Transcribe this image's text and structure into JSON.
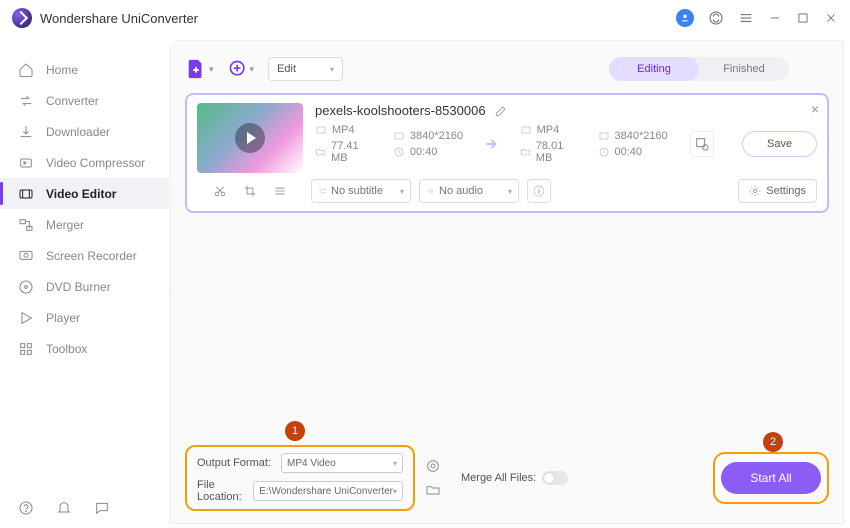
{
  "app": {
    "title": "Wondershare UniConverter"
  },
  "sidebar": {
    "items": [
      {
        "label": "Home"
      },
      {
        "label": "Converter"
      },
      {
        "label": "Downloader"
      },
      {
        "label": "Video Compressor"
      },
      {
        "label": "Video Editor"
      },
      {
        "label": "Merger"
      },
      {
        "label": "Screen Recorder"
      },
      {
        "label": "DVD Burner"
      },
      {
        "label": "Player"
      },
      {
        "label": "Toolbox"
      }
    ]
  },
  "toolbar": {
    "edit_dd": "Edit",
    "tabs": {
      "editing": "Editing",
      "finished": "Finished"
    }
  },
  "card": {
    "filename": "pexels-koolshooters-8530006",
    "src": {
      "format": "MP4",
      "resolution": "3840*2160",
      "size": "77.41 MB",
      "duration": "00:40"
    },
    "dst": {
      "format": "MP4",
      "resolution": "3840*2160",
      "size": "78.01 MB",
      "duration": "00:40"
    },
    "subtitle_dd": "No subtitle",
    "audio_dd": "No audio",
    "settings_label": "Settings",
    "save_label": "Save"
  },
  "footer": {
    "output_format_label": "Output Format:",
    "output_format_value": "MP4 Video",
    "file_location_label": "File Location:",
    "file_location_value": "E:\\Wondershare UniConverter",
    "merge_label": "Merge All Files:",
    "start_label": "Start All",
    "ann1": "1",
    "ann2": "2"
  }
}
